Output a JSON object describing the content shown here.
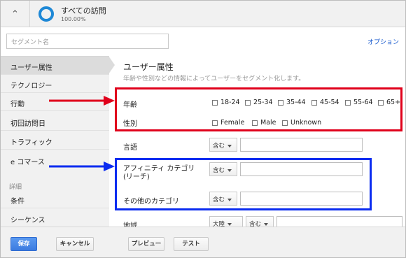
{
  "header": {
    "collapse_icon": "chevron-up-icon",
    "segment_title": "すべての訪問",
    "segment_percent": "100.00%",
    "ring_color": "#1e88d6"
  },
  "segment_name": {
    "placeholder": "セグメント名"
  },
  "options_label": "オプション",
  "sidebar": {
    "items": [
      {
        "label": "ユーザー属性"
      },
      {
        "label": "テクノロジー"
      },
      {
        "label": "行動"
      },
      {
        "label": "初回訪問日"
      },
      {
        "label": "トラフィック"
      },
      {
        "label": "e コマース"
      }
    ],
    "section_label": "詳細",
    "advanced_items": [
      {
        "label": "条件"
      },
      {
        "label": "シーケンス"
      }
    ]
  },
  "main": {
    "title": "ユーザー属性",
    "subtitle": "年齢や性別などの情報によってユーザーをセグメント化します。",
    "age": {
      "label": "年齢",
      "options": [
        "18-24",
        "25-34",
        "35-44",
        "45-54",
        "55-64",
        "65+"
      ]
    },
    "gender": {
      "label": "性別",
      "options": [
        "Female",
        "Male",
        "Unknown"
      ]
    },
    "language": {
      "label": "言語",
      "operator": "含む"
    },
    "affinity": {
      "label": "アフィニティ カテゴリ (リーチ)",
      "operator": "含む"
    },
    "other_category": {
      "label": "その他のカテゴリ",
      "operator": "含む"
    },
    "region": {
      "label": "地域",
      "operator1": "大陸",
      "operator2": "含む"
    }
  },
  "footer": {
    "save_label": "保存",
    "cancel_label": "キャンセル",
    "preview_label": "プレビュー",
    "test_label": "テスト"
  },
  "colors": {
    "highlight_red": "#e0001b",
    "highlight_blue": "#0b2cf0",
    "accent": "#3b7be0"
  }
}
